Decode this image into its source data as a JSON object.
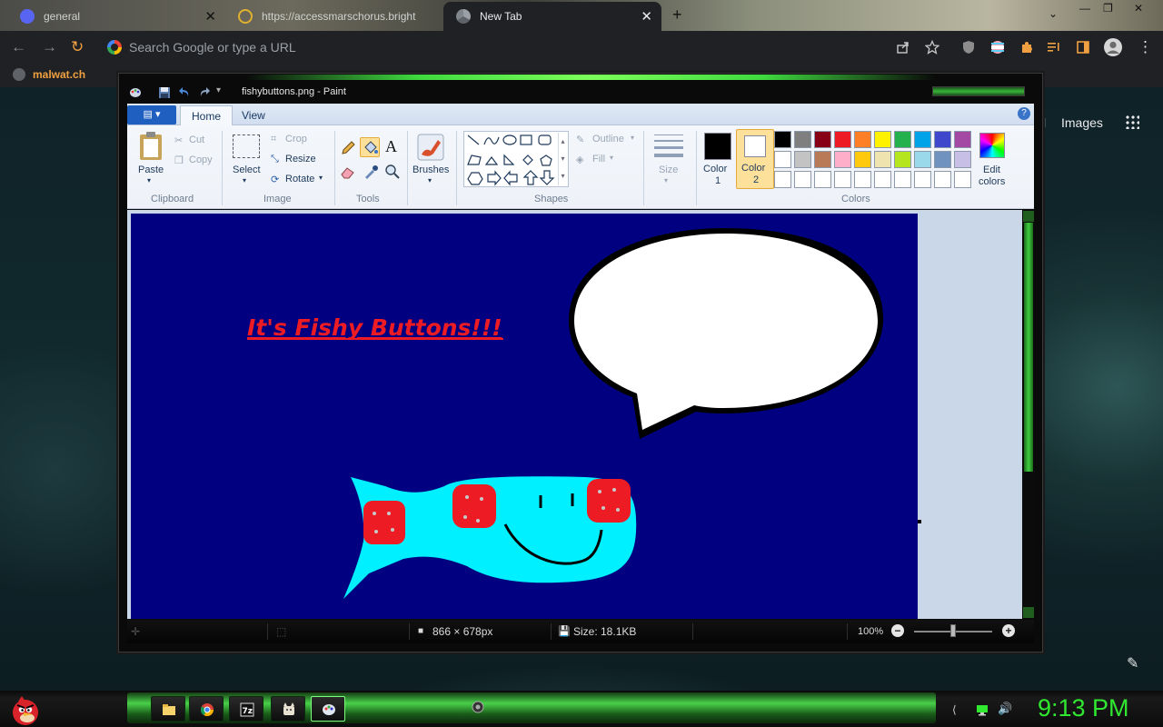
{
  "browser": {
    "tabs": [
      {
        "title": "general",
        "icon": "discord-icon"
      },
      {
        "title": "https://accessmarschorus.bright",
        "icon": "loading-icon"
      },
      {
        "title": "New Tab",
        "icon": "chrome-icon"
      }
    ],
    "omnibox_placeholder": "Search Google or type a URL",
    "bookmark": "malwat.ch",
    "page_links": {
      "partial": "l",
      "images": "Images"
    }
  },
  "paint": {
    "title": "fishybuttons.png - Paint",
    "ribbon_tabs": [
      "Home",
      "View"
    ],
    "clipboard": {
      "paste": "Paste",
      "cut": "Cut",
      "copy": "Copy",
      "label": "Clipboard"
    },
    "image": {
      "select": "Select",
      "crop": "Crop",
      "resize": "Resize",
      "rotate": "Rotate",
      "label": "Image"
    },
    "tools_label": "Tools",
    "brushes": "Brushes",
    "shapes": {
      "outline": "Outline",
      "fill": "Fill",
      "label": "Shapes"
    },
    "size": "Size",
    "colors": {
      "color1": "Color",
      "color1_num": "1",
      "color2": "Color",
      "color2_num": "2",
      "edit": "Edit",
      "edit2": "colors",
      "label": "Colors",
      "palette": [
        "#000000",
        "#7f7f7f",
        "#880015",
        "#ed1c24",
        "#ff7f27",
        "#fff200",
        "#22b14c",
        "#00a2e8",
        "#3f48cc",
        "#a349a4",
        "#ffffff",
        "#c3c3c3",
        "#b97a57",
        "#ffaec9",
        "#ffc90e",
        "#efe4b0",
        "#b5e61d",
        "#99d9ea",
        "#7092be",
        "#c8bfe7"
      ]
    },
    "canvas": {
      "headline": "It's Fishy Buttons!!!",
      "bg_color": "#000080"
    },
    "status": {
      "dimensions": "866 × 678px",
      "size": "Size: 18.1KB",
      "zoom": "100%"
    }
  },
  "taskbar": {
    "clock": "9:13 PM"
  }
}
